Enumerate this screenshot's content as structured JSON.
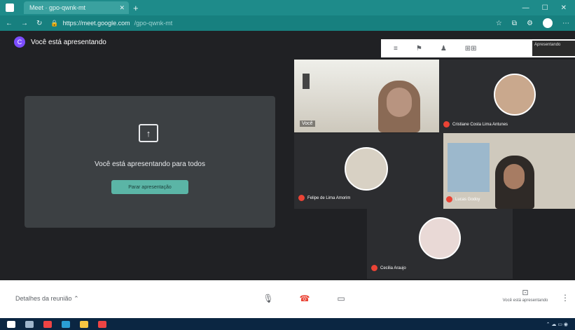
{
  "browser": {
    "tab_title": "Meet · gpo-qwnk-mt",
    "url_domain": "https://meet.google.com",
    "url_path": "/gpo-qwnk-mt"
  },
  "meet": {
    "presenting_label": "Você está apresentando",
    "avatar_letter": "C",
    "present_card": {
      "title": "Você está apresentando para todos",
      "stop_label": "Parar apresentação"
    },
    "toolbar_pop": {
      "thumb_label": "Apresentando"
    },
    "participants": [
      {
        "name": "Você",
        "icon": "camera-feed"
      },
      {
        "name": "Cristiane Costa Lima Antunes",
        "icon": "avatar-photo"
      },
      {
        "name": "Felipe de Lima Amorim",
        "icon": "avatar-photo"
      },
      {
        "name": "Lucas Godoy",
        "icon": "camera-feed"
      },
      {
        "name": "Cecilia Araujo",
        "icon": "avatar-photo"
      }
    ],
    "bottom": {
      "details_label": "Detalhes da reunião",
      "present_now_label": "Você está apresentando"
    }
  },
  "colors": {
    "accent": "#1e8b8a",
    "stop_button": "#5bb5a6",
    "mic_off": "#ea4335"
  }
}
